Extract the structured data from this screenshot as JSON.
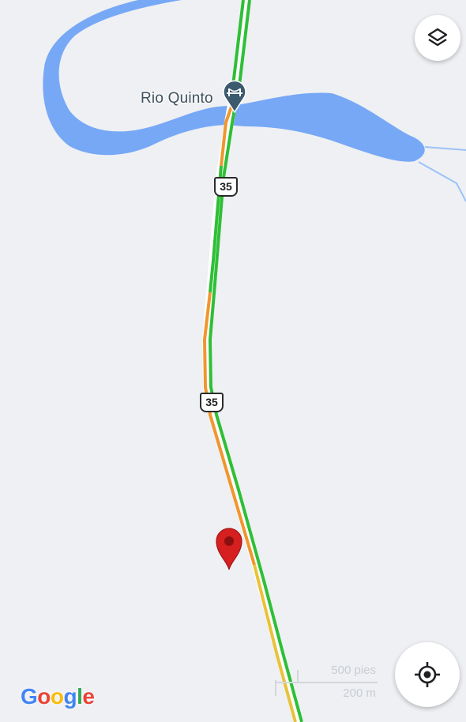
{
  "map": {
    "place": {
      "name": "Rio Quinto",
      "icon": "bridge-place-icon",
      "pin_color": "#3c5a6e"
    },
    "river": {
      "color": "#77a8f6",
      "stream_color": "#9cc2f7"
    },
    "road": {
      "route_number_1": "35",
      "route_number_2": "35",
      "traffic_fast_color": "#2fbf37",
      "traffic_slow_color": "#f0962e"
    },
    "marker": {
      "color": "#d61f1f",
      "icon": "red-location-pin-icon"
    },
    "background_color": "#eef0f3"
  },
  "controls": {
    "layers_icon": "layers-icon",
    "locate_icon": "my-location-icon"
  },
  "scale": {
    "imperial": "500 pies",
    "metric": "200 m"
  },
  "branding": {
    "letters": [
      "G",
      "o",
      "o",
      "g",
      "l",
      "e"
    ],
    "colors": [
      "#4285f4",
      "#ea4335",
      "#fbbc05",
      "#4285f4",
      "#34a853",
      "#ea4335"
    ]
  }
}
